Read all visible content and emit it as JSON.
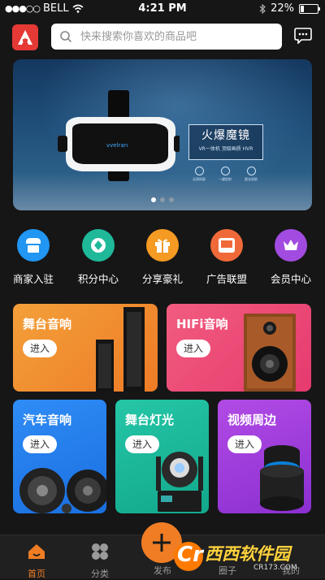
{
  "status_bar": {
    "carrier": "BELL",
    "time": "4:21 PM",
    "battery_percent": "22%",
    "battery_level": 0.22
  },
  "header": {
    "logo_icon": "app-logo-icon",
    "search": {
      "placeholder": "快来搜索你喜欢的商品吧",
      "icon": "search-icon"
    },
    "message_icon": "message-icon"
  },
  "banner": {
    "title": "火爆魔镜",
    "subtitle": "VR一体机 顶级画质 HVR",
    "features": [
      "无线同屏",
      "一键投射",
      "超长续航"
    ],
    "page_count": 3,
    "active_page": 1
  },
  "quick_nav": [
    {
      "label": "商家入驻",
      "icon": "shop-icon",
      "color": "#2196f3"
    },
    {
      "label": "积分中心",
      "icon": "points-icon",
      "color": "#1fb99a"
    },
    {
      "label": "分享豪礼",
      "icon": "gift-icon",
      "color": "#f59a23"
    },
    {
      "label": "广告联盟",
      "icon": "ad-icon",
      "color": "#f06a39"
    },
    {
      "label": "会员中心",
      "icon": "crown-icon",
      "color": "#a24be0"
    }
  ],
  "categories": [
    {
      "title": "舞台音响",
      "button": "进入"
    },
    {
      "title": "HIFi音响",
      "button": "进入"
    },
    {
      "title": "汽车音响",
      "button": "进入"
    },
    {
      "title": "舞台灯光",
      "button": "进入"
    },
    {
      "title": "视频周边",
      "button": "进入"
    }
  ],
  "tab_bar": {
    "tabs": [
      {
        "label": "首页",
        "icon": "home-icon",
        "active": true
      },
      {
        "label": "分类",
        "icon": "category-icon",
        "active": false
      },
      {
        "label": "发布",
        "icon": "publish-icon",
        "active": false
      },
      {
        "label": "圈子",
        "icon": "circle-icon",
        "active": false
      },
      {
        "label": "我的",
        "icon": "profile-icon",
        "active": false
      }
    ],
    "publish_button_icon": "plus-icon",
    "accent": "#f07d24"
  },
  "watermark": {
    "brand": "西西软件园",
    "url": "CR173.COM",
    "mark": "Cr"
  }
}
